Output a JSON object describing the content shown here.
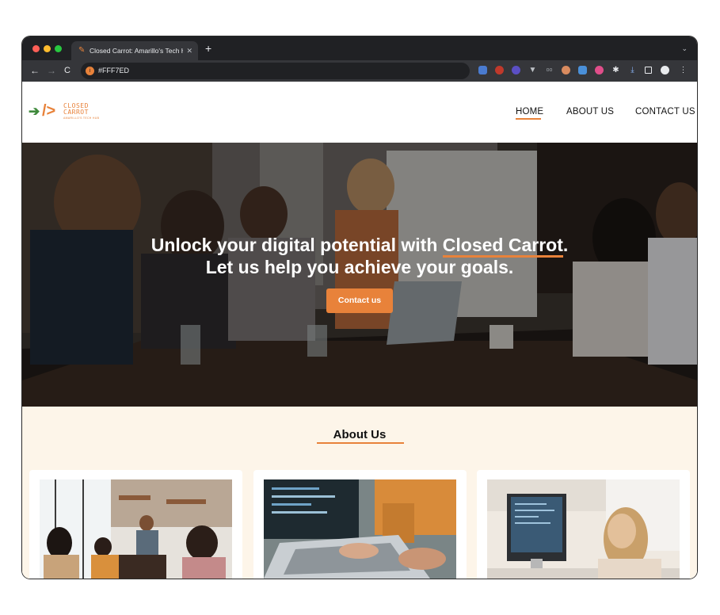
{
  "browser": {
    "tab_title": "Closed Carrot: Amarillo's Tech Hub",
    "tab_close": "✕",
    "new_tab": "+",
    "tab_menu": "⌄",
    "nav_back": "←",
    "nav_forward": "→",
    "nav_reload": "C",
    "address": "#FFF7ED"
  },
  "site": {
    "logo": {
      "arrow": "➔",
      "slash": "/>",
      "line1": "CLOSED",
      "line2": "CARROT",
      "line3": "AMARILLO'S TECH HUB"
    },
    "nav": {
      "home": "HOME",
      "about": "ABOUT US",
      "contact": "CONTACT US"
    },
    "hero": {
      "line1_prefix": "Unlock your digital potential with ",
      "brand": "Closed Carrot",
      "line1_suffix": ".",
      "line2": "Let us help you achieve your goals.",
      "button": "Contact us"
    },
    "about": {
      "title": "About Us"
    }
  },
  "colors": {
    "accent": "#e8823a",
    "green": "#3f8a3c",
    "about_bg": "#fdf5e9"
  }
}
